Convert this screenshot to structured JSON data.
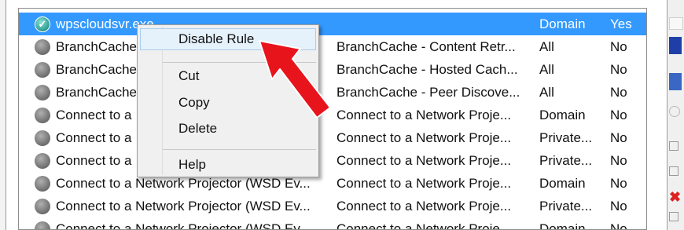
{
  "rules": [
    {
      "name": "wpscloudsvr.exe",
      "group": "",
      "profile": "Domain",
      "enabled": "Yes",
      "selected": true,
      "icon": "allow-check-icon"
    },
    {
      "name": "BranchCache",
      "group": "BranchCache - Content Retr...",
      "profile": "All",
      "enabled": "No",
      "icon": "disabled-rule-icon"
    },
    {
      "name": "BranchCache",
      "group": "BranchCache - Hosted Cach...",
      "profile": "All",
      "enabled": "No",
      "icon": "disabled-rule-icon"
    },
    {
      "name": "BranchCache",
      "group": "BranchCache - Peer Discove...",
      "profile": "All",
      "enabled": "No",
      "icon": "disabled-rule-icon"
    },
    {
      "name": "Connect to a",
      "group": "Connect to a Network Proje...",
      "profile": "Domain",
      "enabled": "No",
      "icon": "disabled-rule-icon"
    },
    {
      "name": "Connect to a",
      "group": "Connect to a Network Proje...",
      "profile": "Private...",
      "enabled": "No",
      "icon": "disabled-rule-icon"
    },
    {
      "name": "Connect to a",
      "group": "Connect to a Network Proje...",
      "profile": "Private...",
      "enabled": "No",
      "icon": "disabled-rule-icon"
    },
    {
      "name": "Connect to a Network Projector (WSD Ev...",
      "group": "Connect to a Network Proje...",
      "profile": "Domain",
      "enabled": "No",
      "icon": "disabled-rule-icon"
    },
    {
      "name": "Connect to a Network Projector (WSD Ev...",
      "group": "Connect to a Network Proje...",
      "profile": "Private...",
      "enabled": "No",
      "icon": "disabled-rule-icon"
    },
    {
      "name": "Connect to a Network Projector (WSD Ev...",
      "group": "Connect to a Network Proje...",
      "profile": "Domain",
      "enabled": "No",
      "icon": "disabled-rule-icon"
    }
  ],
  "context_menu": {
    "items": [
      {
        "label": "Disable Rule",
        "highlighted": true
      },
      {
        "label": "Cut"
      },
      {
        "label": "Copy"
      },
      {
        "label": "Delete"
      },
      {
        "label": "Help"
      }
    ]
  },
  "annotation": {
    "type": "red-arrow",
    "color": "#e8141c",
    "points_to": "Disable Rule"
  },
  "colors": {
    "selection": "#3399ff",
    "menu_bg": "#f0f0f0",
    "menu_hover": "#e5f1fb"
  }
}
